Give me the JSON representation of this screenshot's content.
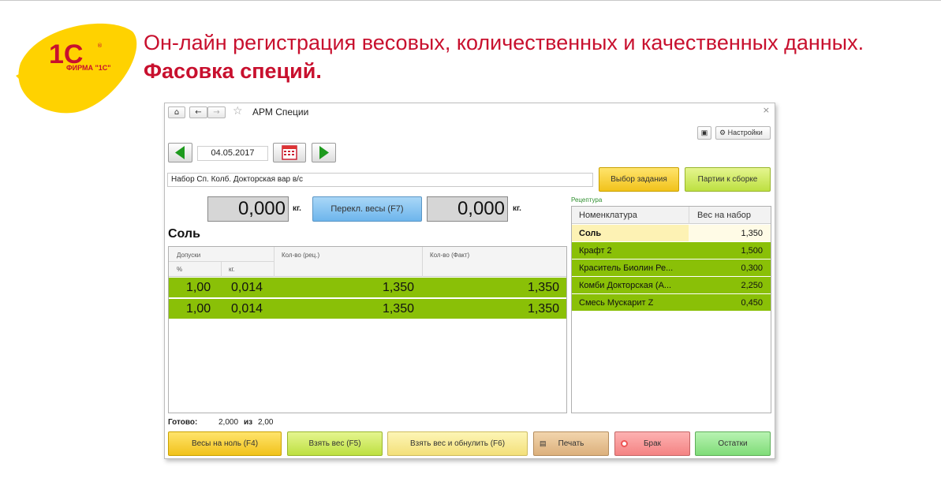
{
  "brand": {
    "logo_mark": "1C",
    "logo_text": "ФИРМА \"1С\"",
    "accent_color": "#c8102e"
  },
  "slide": {
    "title_regular": "Он-лайн регистрация весовых, количественных и качественных данных. ",
    "title_bold": "Фасовка специй."
  },
  "window": {
    "title": "АРМ Специи",
    "settings_label": "Настройки",
    "date": "04.05.2017",
    "task": "Набор Сп. Колб. Докторская вар в/с",
    "btn_select_task": "Выбор задания",
    "btn_batches": "Партии к сборке",
    "weight_left": "0,000",
    "weight_right": "0,000",
    "unit": "кг.",
    "btn_switch_scales": "Перекл. весы (F7)",
    "product_name": "Соль",
    "grid": {
      "col_tolerance": "Допуски",
      "col_percent": "%",
      "col_kg": "кг.",
      "col_qty_recipe": "Кол-во (рец.)",
      "col_qty_fact": "Кол-во (Факт)",
      "rows": [
        {
          "percent": "1,00",
          "kg": "0,014",
          "recipe": "1,350",
          "fact": "1,350"
        },
        {
          "percent": "1,00",
          "kg": "0,014",
          "recipe": "1,350",
          "fact": "1,350"
        }
      ]
    },
    "recipe": {
      "label": "Рецептура",
      "col_name": "Номенклатура",
      "col_weight": "Вес на набор",
      "rows": [
        {
          "name": "Соль",
          "weight": "1,350",
          "state": "current"
        },
        {
          "name": "Крафт 2",
          "weight": "1,500",
          "state": "done"
        },
        {
          "name": "Краситель Биолин Ре...",
          "weight": "0,300",
          "state": "done"
        },
        {
          "name": "Комби Докторская (А...",
          "weight": "2,250",
          "state": "done"
        },
        {
          "name": "Смесь Мускарит Z",
          "weight": "0,450",
          "state": "done"
        }
      ]
    },
    "ready": {
      "label": "Готово:",
      "done": "2,000",
      "of": "из",
      "total": "2,00"
    },
    "buttons": {
      "zero": "Весы на ноль (F4)",
      "take": "Взять вес (F5)",
      "take_reset": "Взять вес и обнулить (F6)",
      "print": "Печать",
      "reject": "Брак",
      "rest": "Остатки"
    },
    "colors": {
      "row_green": "#8ac007",
      "current_row": "#fdf2b4",
      "done_row": "#8ac007"
    }
  }
}
